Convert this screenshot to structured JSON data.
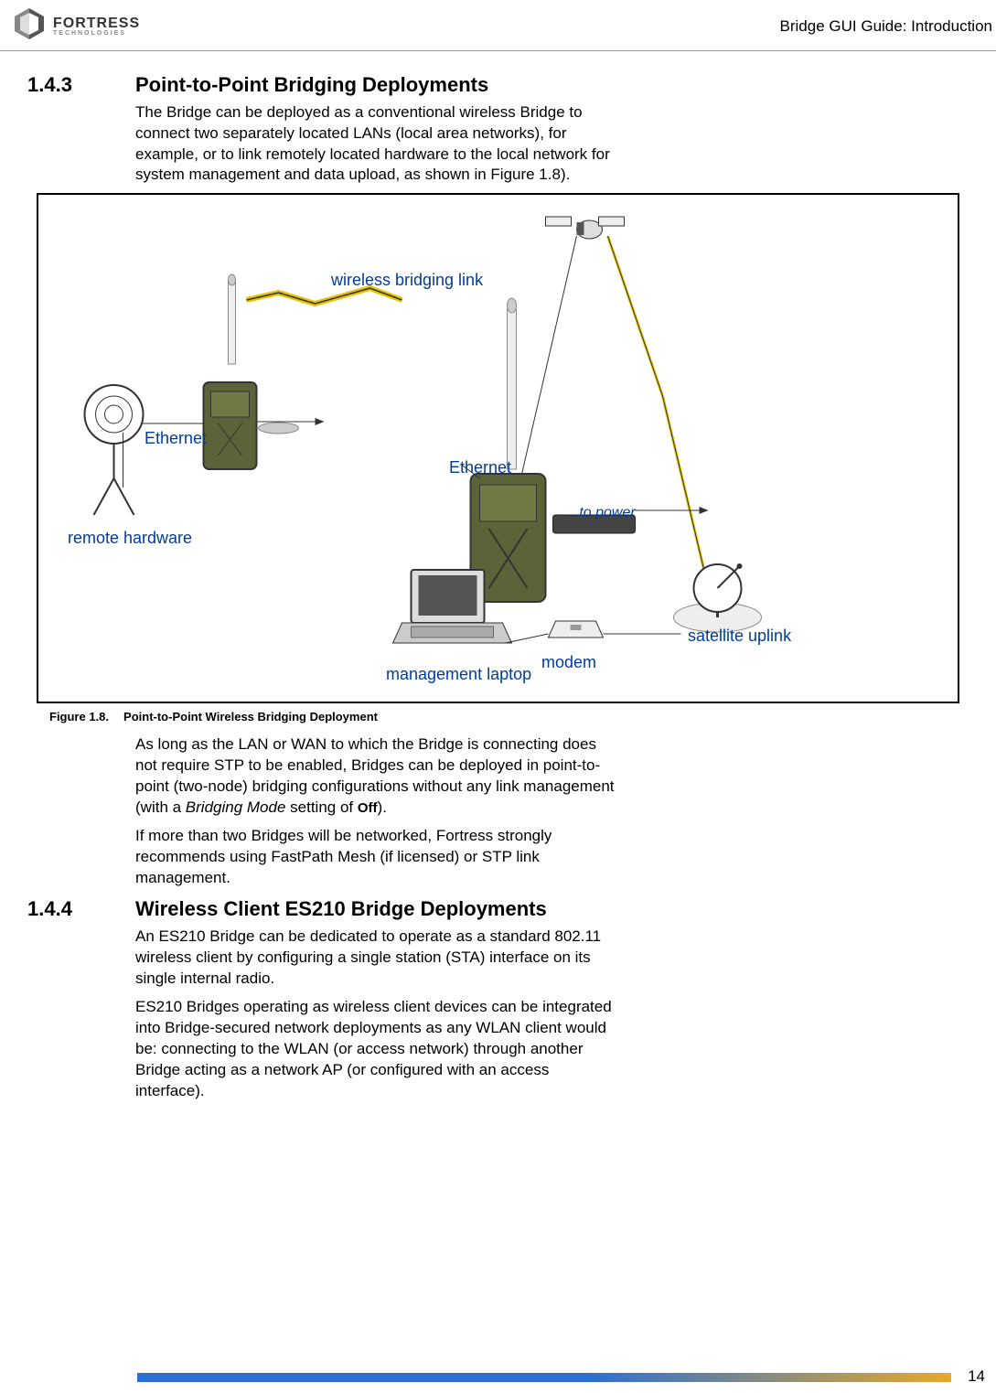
{
  "header": {
    "brand_line1": "FORTRESS",
    "brand_line2": "TECHNOLOGIES",
    "right": "Bridge GUI Guide: Introduction"
  },
  "section1": {
    "num": "1.4.3",
    "title": "Point-to-Point Bridging Deployments",
    "para1": "The Bridge can be deployed as a conventional wireless Bridge to connect two separately located LANs (local area networks), for example, or to link remotely located hardware to the local network for system management and data upload, as shown in Figure 1.8)."
  },
  "figure": {
    "labels": {
      "wireless_link": "wireless bridging link",
      "ethernet1": "Ethernet",
      "ethernet2": "Ethernet",
      "remote_hw": "remote hardware",
      "to_power": "...to power",
      "sat_uplink": "satellite uplink",
      "modem": "modem",
      "mgmt_laptop": "management laptop"
    },
    "caption_num": "Figure 1.8.",
    "caption_text": "Point-to-Point Wireless Bridging Deployment"
  },
  "after_fig": {
    "para2a": "As long as the LAN or WAN to which the Bridge is connecting does not require STP to be enabled, Bridges can be deployed in point-to-point (two-node) bridging configurations without any link management (with a ",
    "para2b_italic": "Bridging Mode",
    "para2c": " setting of ",
    "para2d_bold": "Off",
    "para2e": ").",
    "para3": "If more than two Bridges will be networked, Fortress strongly recommends using FastPath Mesh (if licensed) or STP link management."
  },
  "section2": {
    "num": "1.4.4",
    "title": "Wireless Client ES210 Bridge Deployments",
    "para1": "An ES210 Bridge can be dedicated to operate as a standard 802.11 wireless client by configuring a single station (STA) interface on its single internal radio.",
    "para2": "ES210 Bridges operating as wireless client devices can be integrated into Bridge-secured network deployments as any WLAN client would be: connecting to the WLAN (or access network) through another Bridge acting as a network AP (or configured with an access interface)."
  },
  "page_number": "14"
}
